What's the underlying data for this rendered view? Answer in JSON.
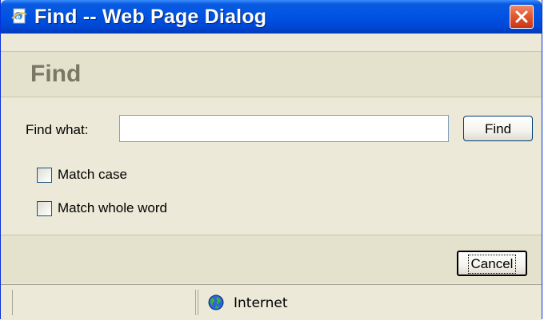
{
  "window": {
    "title": "Find -- Web Page Dialog",
    "title_icon": "ie-page-icon",
    "close_icon": "close-icon"
  },
  "header": {
    "title": "Find"
  },
  "form": {
    "find_label": "Find what:",
    "find_value": "",
    "find_placeholder": "",
    "find_button": "Find",
    "match_case_label": "Match case",
    "match_case_checked": false,
    "match_whole_word_label": "Match whole word",
    "match_whole_word_checked": false
  },
  "footer": {
    "cancel_button": "Cancel"
  },
  "statusbar": {
    "left_text": "",
    "zone_label": "Internet",
    "zone_icon": "globe-icon"
  },
  "colors": {
    "titlebar": "#0054e3",
    "dialog_bg": "#ece9d8",
    "band_bg": "#e4e2cc",
    "header_text": "#7a7863",
    "close_button": "#e25a2f"
  }
}
